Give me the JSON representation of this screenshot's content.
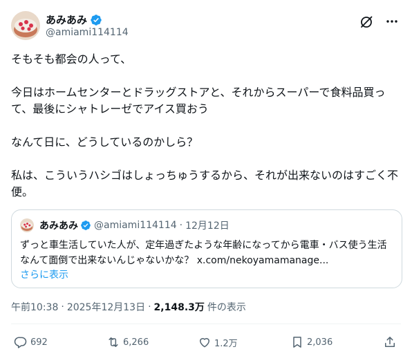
{
  "author": {
    "display_name": "あみあみ",
    "handle": "@amiami114114"
  },
  "tweet": {
    "lines": [
      "そもそも都会の人って、",
      "今日はホームセンターとドラッグストアと、それからスーパーで食料品買って、最後にシャトレーゼでアイス買おう",
      "なんて日に、どうしているのかしら？",
      "私は、こういうハシゴはしょっちゅうするから、それが出来ないのはすごく不便。"
    ]
  },
  "quote": {
    "display_name": "あみあみ",
    "handle": "@amiami114114",
    "separator": "·",
    "date": "12月12日",
    "text": "ずっと車生活していた人が、定年過ぎたような年齢になってから電車・バス使う生活なんて面倒で出来ないんじゃないかな？ x.com/nekoyamamanage...",
    "show_more": "さらに表示"
  },
  "meta": {
    "time": "午前10:38",
    "separator": "·",
    "date": "2025年12月13日",
    "views": "2,148.3万",
    "views_label": "件の表示"
  },
  "actions": {
    "replies": "692",
    "retweets": "6,266",
    "likes": "1.2万",
    "bookmarks": "2,036"
  },
  "icons": {
    "verified": "verified-badge-icon",
    "grok": "grok-icon",
    "more": "more-icon",
    "reply": "reply-icon",
    "retweet": "retweet-icon",
    "like": "heart-icon",
    "bookmark": "bookmark-icon",
    "share": "share-icon"
  },
  "colors": {
    "accent": "#1d9bf0",
    "muted": "#536471",
    "text": "#0f1419",
    "border": "#cfd9de"
  }
}
